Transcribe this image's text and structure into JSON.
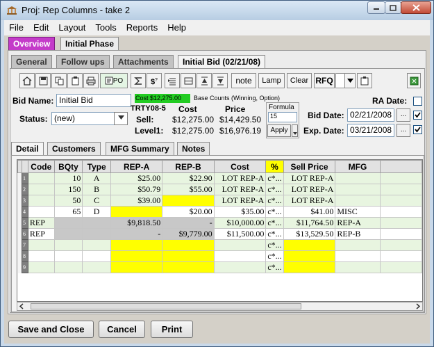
{
  "window": {
    "title": "Proj: Rep Columns - take 2"
  },
  "menu": [
    "File",
    "Edit",
    "Layout",
    "Tools",
    "Reports",
    "Help"
  ],
  "top_tabs": {
    "overview": "Overview",
    "initial_phase": "Initial Phase"
  },
  "sub_tabs": {
    "general": "General",
    "follow_ups": "Follow ups",
    "attachments": "Attachments",
    "initial_bid": "Initial Bid (02/21/08)"
  },
  "toolbar": {
    "po_label": "PO",
    "note": "note",
    "lamp": "Lamp",
    "clear": "Clear",
    "rfq": "RFQ"
  },
  "bid": {
    "name_label": "Bid Name:",
    "name_value": "Initial Bid",
    "status_label": "Status:",
    "status_value": "(new)",
    "cost_badge": "Cost $12,275.00",
    "base_counts": "Base Counts (Winning, Option)",
    "ref": "TRTY08-5",
    "cost_header": "Cost",
    "price_header": "Price",
    "sell_label": "Sell:",
    "sell_cost": "$12,275.00",
    "sell_price": "$14,429.50",
    "level_label": "Level1:",
    "level_cost": "$12,275.00",
    "level_price": "$16,976.19",
    "formula_label": "Formula",
    "formula_value": "15",
    "apply_label": "Apply",
    "ra_date_label": "RA Date:",
    "bid_date_label": "Bid Date:",
    "bid_date_value": "02/21/2008",
    "exp_date_label": "Exp. Date:",
    "exp_date_value": "03/21/2008",
    "ellipsis": "...",
    "bid_date_checked": true,
    "exp_date_checked": true,
    "ra_date_checked": false
  },
  "detail_tabs": {
    "detail": "Detail",
    "customers": "Customers",
    "mfg_summary": "MFG Summary",
    "notes": "Notes"
  },
  "table": {
    "headers": [
      "Code",
      "BQty",
      "Type",
      "REP-A",
      "REP-B",
      "Cost",
      "%",
      "Sell Price",
      "MFG"
    ],
    "rows": [
      {
        "num": "1",
        "code": "",
        "bqty": "10",
        "type": "A",
        "repa": "$25.00",
        "repb": "$22.90",
        "cost": "LOT REP-A",
        "pct": "c*...",
        "sell": "LOT REP-A",
        "mfg": "",
        "color": "#e8f5e0"
      },
      {
        "num": "2",
        "code": "",
        "bqty": "150",
        "type": "B",
        "repa": "$50.79",
        "repb": "$55.00",
        "cost": "LOT REP-A",
        "pct": "c*...",
        "sell": "LOT REP-A",
        "mfg": "",
        "color": "#e8f5e0"
      },
      {
        "num": "3",
        "code": "",
        "bqty": "50",
        "type": "C",
        "repa": "$39.00",
        "repb": "",
        "cost": "LOT REP-A",
        "pct": "c*...",
        "sell": "LOT REP-A",
        "mfg": "",
        "color": "#e8f5e0"
      },
      {
        "num": "4",
        "code": "",
        "bqty": "65",
        "type": "D",
        "repa": "",
        "repb": "$20.00",
        "cost": "$35.00",
        "pct": "c*...",
        "sell": "$41.00",
        "mfg": "MISC",
        "color": "#ffffff"
      },
      {
        "num": "5",
        "code": "REP",
        "bqty": "",
        "type": "",
        "repa": "$9,818.50",
        "repb": "-",
        "cost": "$10,000.00",
        "pct": "c*...",
        "sell": "$11,764.50",
        "mfg": "REP-A",
        "color": "#e8f5e0"
      },
      {
        "num": "6",
        "code": "REP",
        "bqty": "",
        "type": "",
        "repa": "-",
        "repb": "$9,779.00",
        "cost": "$11,500.00",
        "pct": "c*...",
        "sell": "$13,529.50",
        "mfg": "REP-B",
        "color": "#ffffff"
      },
      {
        "num": "7",
        "code": "",
        "bqty": "",
        "type": "",
        "repa": "",
        "repb": "",
        "cost": "",
        "pct": "c*...",
        "sell": "",
        "mfg": "",
        "color": "#e8f5e0"
      },
      {
        "num": "8",
        "code": "",
        "bqty": "",
        "type": "",
        "repa": "",
        "repb": "",
        "cost": "",
        "pct": "c*...",
        "sell": "",
        "mfg": "",
        "color": "#ffffff"
      },
      {
        "num": "9",
        "code": "",
        "bqty": "",
        "type": "",
        "repa": "",
        "repb": "",
        "cost": "",
        "pct": "c*...",
        "sell": "",
        "mfg": "",
        "color": "#e8f5e0"
      }
    ]
  },
  "buttons": {
    "save_close": "Save and Close",
    "cancel": "Cancel",
    "print": "Print"
  },
  "colors": {
    "highlight_yellow": "#ffff00",
    "cost_green": "#22cc22",
    "overview_magenta": "#c43bc9"
  }
}
